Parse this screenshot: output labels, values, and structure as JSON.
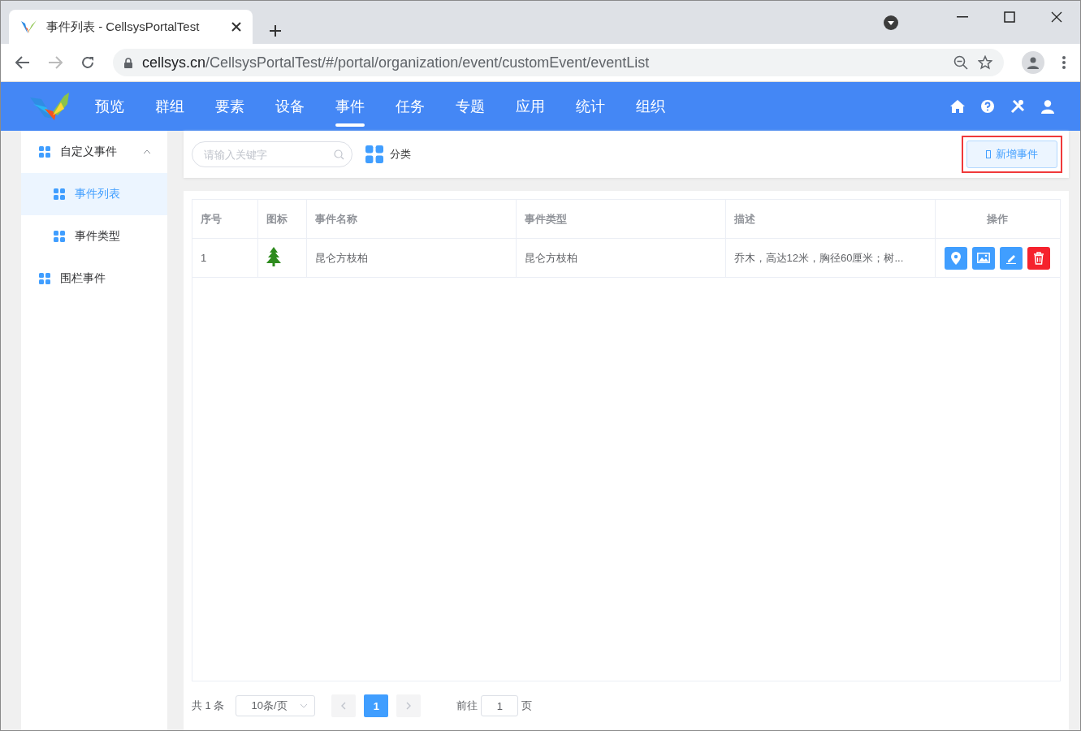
{
  "browser": {
    "tab_title": "事件列表 - CellsysPortalTest",
    "url_host": "cellsys.cn",
    "url_path": "/CellsysPortalTest/#/portal/organization/event/customEvent/eventList"
  },
  "nav": {
    "items": [
      {
        "label": "预览",
        "selected": false
      },
      {
        "label": "群组",
        "selected": false
      },
      {
        "label": "要素",
        "selected": false
      },
      {
        "label": "设备",
        "selected": false
      },
      {
        "label": "事件",
        "selected": true
      },
      {
        "label": "任务",
        "selected": false
      },
      {
        "label": "专题",
        "selected": false
      },
      {
        "label": "应用",
        "selected": false
      },
      {
        "label": "统计",
        "selected": false
      },
      {
        "label": "组织",
        "selected": false
      }
    ]
  },
  "sidebar": {
    "items": [
      {
        "label": "自定义事件",
        "expanded": true,
        "selected": false,
        "children": [
          {
            "label": "事件列表",
            "selected": true
          },
          {
            "label": "事件类型",
            "selected": false
          }
        ]
      },
      {
        "label": "围栏事件",
        "selected": false
      }
    ]
  },
  "toolbar": {
    "search": {
      "placeholder": "请输入关键字"
    },
    "category": "分类",
    "add_button": "新增事件",
    "highlighted": true
  },
  "table": {
    "columns": [
      "序号",
      "图标",
      "事件名称",
      "事件类型",
      "描述",
      "操作"
    ],
    "rows": [
      {
        "index": "1",
        "name": "昆仑方枝柏",
        "type": "昆仑方枝柏",
        "description": "乔木，高达12米，胸径60厘米；树..."
      }
    ]
  },
  "pagination": {
    "total": "共 1 条",
    "page_size": "10条/页",
    "pages": [
      {
        "label": "1",
        "selected": true
      }
    ],
    "goto_label": "前往",
    "goto_value": "1",
    "page_unit": "页"
  }
}
